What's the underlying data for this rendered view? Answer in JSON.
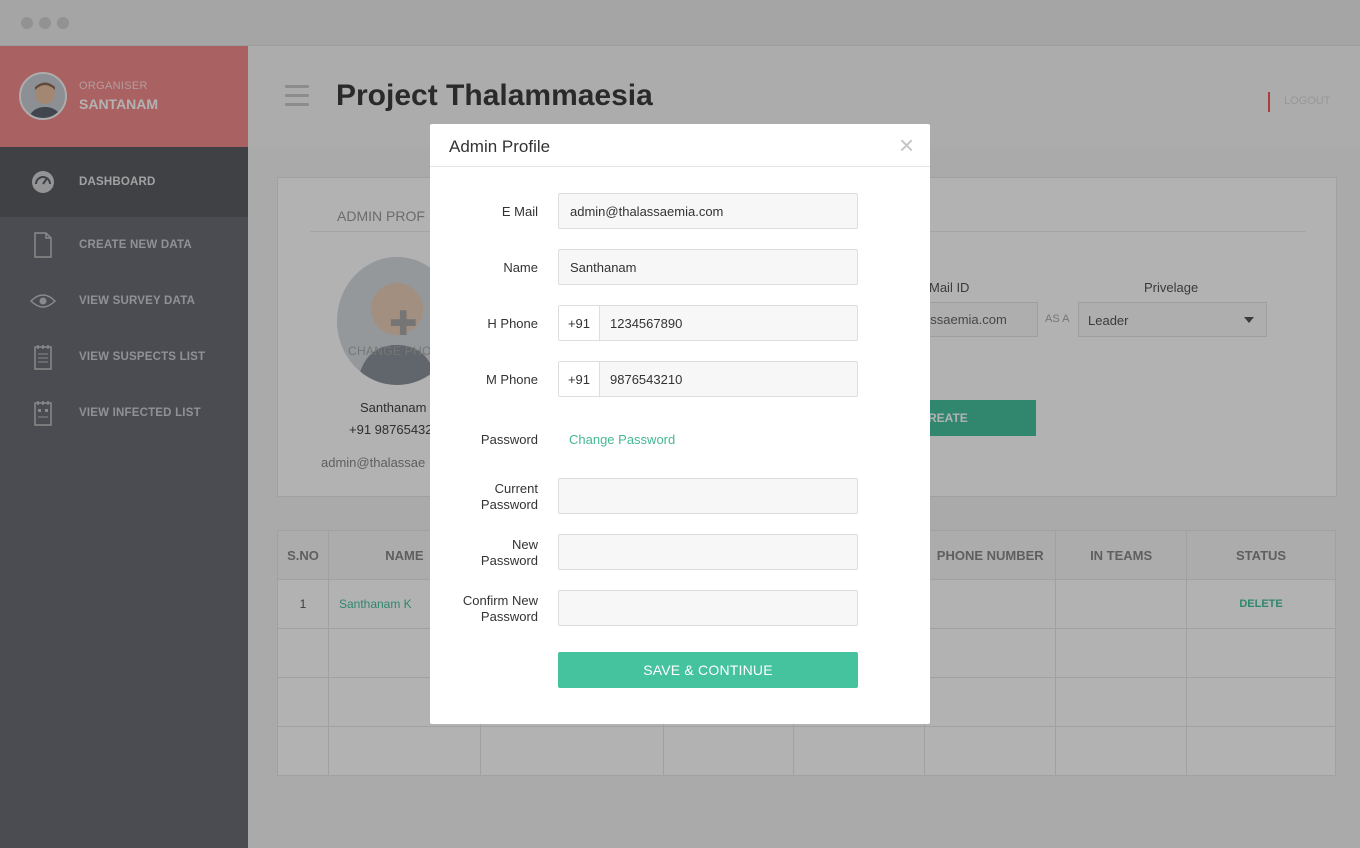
{
  "sidebar": {
    "role": "ORGANISER",
    "user_name": "SANTANAM",
    "items": [
      {
        "label": "DASHBOARD",
        "icon": "dashboard-gauge-icon"
      },
      {
        "label": "CREATE NEW DATA",
        "icon": "document-icon"
      },
      {
        "label": "VIEW SURVEY  DATA",
        "icon": "eye-icon"
      },
      {
        "label": "VIEW SUSPECTS LIST",
        "icon": "notepad-icon"
      },
      {
        "label": "VIEW INFECTED LIST",
        "icon": "notepad-alert-icon"
      }
    ]
  },
  "header": {
    "title": "Project Thalammaesia",
    "logout": "LOGOUT"
  },
  "card": {
    "title": "ADMIN PROF",
    "change_photo": "CHANGE PHO",
    "name": "Santhanam",
    "phone": "+91 98765432",
    "email": "admin@thalassae",
    "mail_id_label": "Mail ID",
    "mail_value": "assaemia.com",
    "as_a": "AS A",
    "privilege_label": "Privelage",
    "privilege_value": "Leader",
    "create_button": "REATE"
  },
  "table": {
    "headers": [
      "S.NO",
      "NAME",
      "",
      "",
      "",
      "PHONE NUMBER",
      "IN TEAMS",
      "STATUS"
    ],
    "rows": [
      {
        "sno": "1",
        "name": "Santhanam K",
        "status": "DELETE"
      }
    ]
  },
  "modal": {
    "title": "Admin Profile",
    "close": "×",
    "email_label": "E Mail",
    "email_value": "admin@thalassaemia.com",
    "name_label": "Name",
    "name_value": "Santhanam",
    "hphone_label": "H Phone",
    "hphone_prefix": "+91",
    "hphone_value": "1234567890",
    "mphone_label": "M Phone",
    "mphone_prefix": "+91",
    "mphone_value": "9876543210",
    "password_label": "Password",
    "change_password": "Change Password",
    "current_password_label_1": "Current",
    "current_password_label_2": "Password",
    "new_password_label_1": "New",
    "new_password_label_2": "Password",
    "confirm_password_label_1": "Confirm New",
    "confirm_password_label_2": "Password",
    "save_button": "SAVE & CONTINUE"
  },
  "colors": {
    "accent": "#45c29e",
    "sidebar_header": "#f48b8b",
    "sidebar": "#6b6d74",
    "logout_separator": "#f25a5a"
  }
}
